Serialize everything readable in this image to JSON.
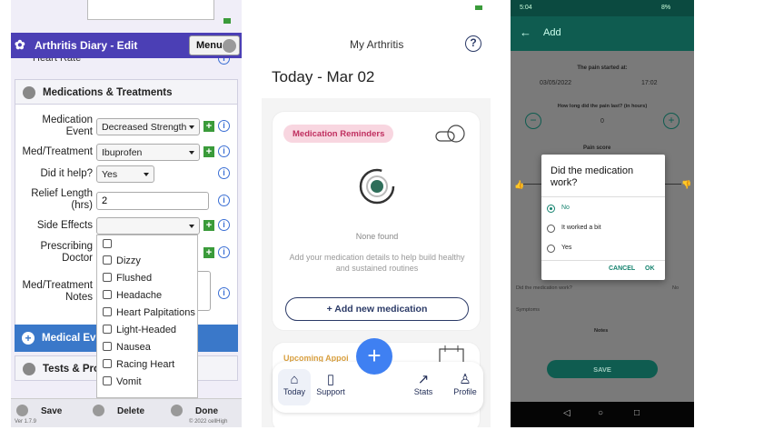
{
  "panel1": {
    "title": "Arthritis Diary - Edit",
    "menu_label": "Menu",
    "partial_label": "Heart Rate",
    "section_meds": "Medications & Treatments",
    "labels": {
      "med_event_1": "Medication",
      "med_event_2": "Event",
      "med_treatment": "Med/Treatment",
      "did_help": "Did it help?",
      "relief_1": "Relief Length",
      "relief_2": "(hrs)",
      "side_effects": "Side Effects",
      "prescribing_1": "Prescribing",
      "prescribing_2": "Doctor",
      "notes_1": "Med/Treatment",
      "notes_2": "Notes"
    },
    "values": {
      "med_event": "Decreased Strength",
      "med_treatment": "Ibuprofen",
      "did_help": "Yes",
      "relief_length": "2"
    },
    "side_effect_options": [
      "Dizzy",
      "Flushed",
      "Headache",
      "Heart Palpitations",
      "Light-Headed",
      "Nausea",
      "Racing Heart",
      "Vomit"
    ],
    "section_medical": "Medical Eve",
    "section_tests": "Tests & Proc",
    "footer": {
      "save": "Save",
      "delete": "Delete",
      "done": "Done",
      "version": "Ver 1.7.9",
      "copyright": "© 2022 cellHigh"
    },
    "colors": {
      "header": "#4b3fb5",
      "add": "#3a9b3a",
      "info": "#3b6fd4",
      "medical_bar": "#3a78c9"
    }
  },
  "panel2": {
    "app_title": "My Arthritis",
    "help": "?",
    "date": "Today - Mar 02",
    "reminders_pill": "Medication Reminders",
    "none_found": "None found",
    "description": "Add your medication details to help build healthy and sustained routines",
    "add_button": "+ Add new medication",
    "partial_card": "Upcoming Appoi",
    "fab": "+",
    "nav": [
      "Today",
      "Support",
      "Stats",
      "Profile"
    ],
    "colors": {
      "fab": "#3f80f2",
      "pill_bg": "#f8d6e0",
      "navy": "#2b3a67"
    }
  },
  "panel3": {
    "status_time": "5:04",
    "status_right": "8%",
    "title": "Add",
    "pain_started": "The pain started at:",
    "date": "03/05/2022",
    "time": "17:02",
    "how_long": "How long did the pain last? (in hours)",
    "hours": "0",
    "pain_score": "Pain score",
    "dialog_title": "Did the medication work?",
    "options": [
      "No",
      "It worked a bit",
      "Yes"
    ],
    "selected": "No",
    "cancel": "CANCEL",
    "ok": "OK",
    "behind_label": "Did the medication work?",
    "behind_value": "No",
    "symptoms": "Symptoms",
    "notes": "Notes",
    "save": "SAVE",
    "colors": {
      "appbar": "#0f5c50",
      "accent": "#14826e"
    }
  }
}
